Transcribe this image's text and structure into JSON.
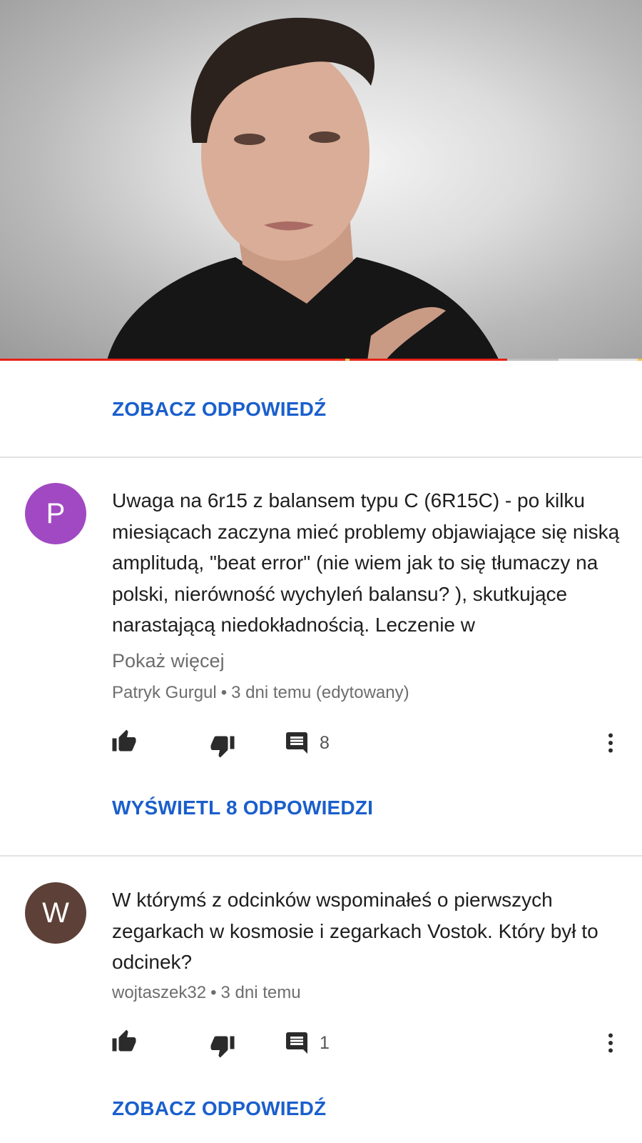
{
  "video": {
    "progress_played": 0.79,
    "progress_buffered": 0.87,
    "colors": {
      "progress": "#e62117",
      "buffer": "#bdbdbd",
      "track": "#e0e0e0",
      "chapter": "#f2c14e"
    }
  },
  "top": {
    "see_reply": "ZOBACZ ODPOWIEDŹ"
  },
  "comments": [
    {
      "avatar_letter": "P",
      "avatar_color": "#a149c2",
      "text": "Uwaga na 6r15 z balansem typu C (6R15C) - po kilku miesiącach zaczyna mieć problemy objawiające się niską amplitudą, \"beat error\" (nie wiem jak to się tłumaczy na polski, nierówność wychyleń balansu? ), skutkujące narastającą niedokładnością. Leczenie w",
      "show_more": "Pokaż więcej",
      "author": "Patryk Gurgul",
      "time": "3 dni temu (edytowany)",
      "reply_count": "8",
      "view_replies": "WYŚWIETL 8 ODPOWIEDZI"
    },
    {
      "avatar_letter": "W",
      "avatar_color": "#5d4037",
      "text": "W którymś z odcinków wspominałeś o pierwszych zegarkach w kosmosie i zegarkach Vostok. Który był to odcinek?",
      "author": "wojtaszek32",
      "time": "3 dni temu",
      "reply_count": "1",
      "view_replies": "ZOBACZ ODPOWIEDŹ"
    }
  ],
  "icons": {
    "like": "thumb-up-icon",
    "dislike": "thumb-down-icon",
    "reply": "comment-icon",
    "menu": "more-vert-icon"
  }
}
